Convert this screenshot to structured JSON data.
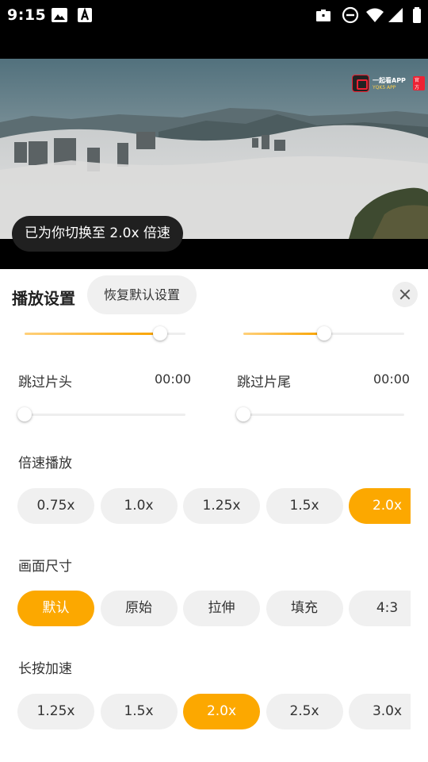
{
  "status_bar": {
    "time": "9:15"
  },
  "video": {
    "logo_title": "一起看APP",
    "logo_sub": "YQK5 APP",
    "logo_badge": "官方"
  },
  "toast": "已为你切换至 2.0x 倍速",
  "sheet": {
    "title": "播放设置",
    "reset_label": "恢复默认设置",
    "top_sliders": {
      "left_fraction": 0.84,
      "right_fraction": 0.5
    },
    "skip_intro": {
      "label": "跳过片头",
      "value": "00:00",
      "fraction": 0
    },
    "skip_outro": {
      "label": "跳过片尾",
      "value": "00:00",
      "fraction": 0
    },
    "speed": {
      "label": "倍速播放",
      "options": [
        "0.75x",
        "1.0x",
        "1.25x",
        "1.5x",
        "2.0x"
      ],
      "selected": "2.0x"
    },
    "aspect": {
      "label": "画面尺寸",
      "options": [
        "默认",
        "原始",
        "拉伸",
        "填充",
        "4:3"
      ],
      "selected": "默认"
    },
    "long_press": {
      "label": "长按加速",
      "options": [
        "1.25x",
        "1.5x",
        "2.0x",
        "2.5x",
        "3.0x"
      ],
      "selected": "2.0x"
    }
  },
  "colors": {
    "accent": "#fca800",
    "chip_bg": "#f0f0f0",
    "sheet_bg": "#ffffff"
  }
}
